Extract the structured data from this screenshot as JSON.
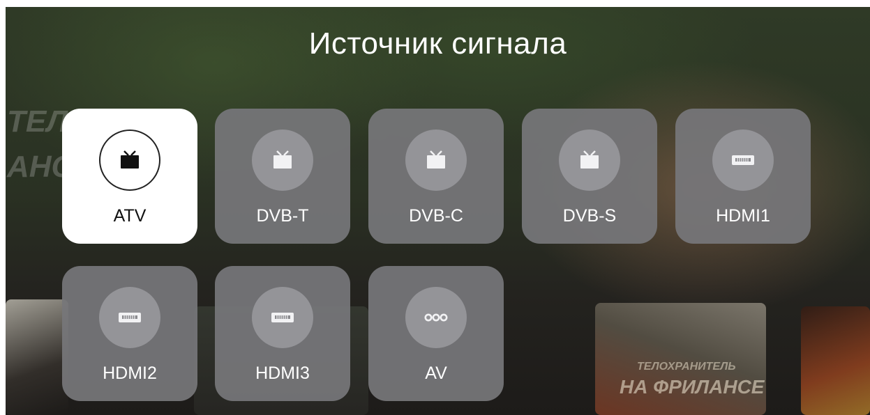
{
  "title": "Источник сигнала",
  "sources": [
    {
      "label": "ATV",
      "icon": "tv-icon",
      "selected": true
    },
    {
      "label": "DVB-T",
      "icon": "tv-icon",
      "selected": false
    },
    {
      "label": "DVB-C",
      "icon": "tv-icon",
      "selected": false
    },
    {
      "label": "DVB-S",
      "icon": "tv-icon",
      "selected": false
    },
    {
      "label": "HDMI1",
      "icon": "hdmi-icon",
      "selected": false
    },
    {
      "label": "HDMI2",
      "icon": "hdmi-icon",
      "selected": false
    },
    {
      "label": "HDMI3",
      "icon": "hdmi-icon",
      "selected": false
    },
    {
      "label": "AV",
      "icon": "av-icon",
      "selected": false
    }
  ],
  "background": {
    "poster_text_left": "ТЕЛЬ",
    "poster_text_left2": "АНС",
    "poster_text_right_1": "ТЕЛОХРАНИТЕЛЬ",
    "poster_text_right_2": "НА ФРИЛАНСЕ"
  },
  "colors": {
    "tile": "#76767a",
    "tile_selected": "#ffffff",
    "icon_circle": "#96969a"
  }
}
